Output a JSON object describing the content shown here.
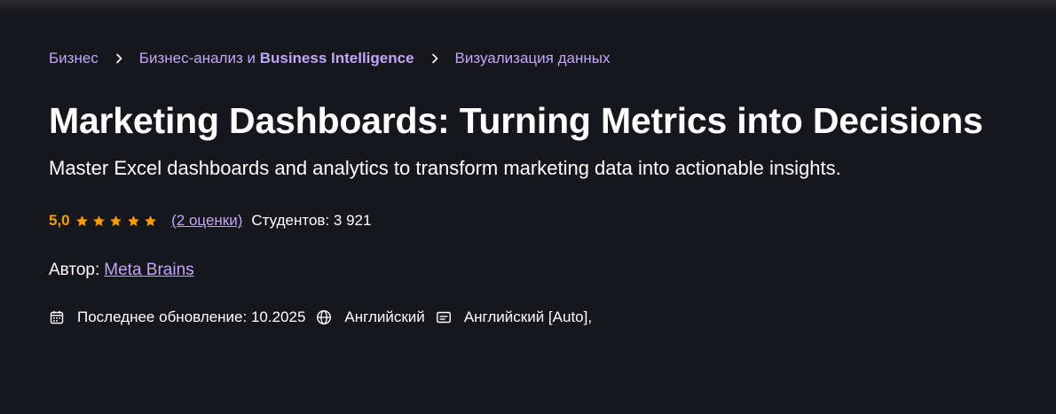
{
  "breadcrumb": {
    "items": [
      {
        "label": "Бизнес"
      },
      {
        "label_prefix": "Бизнес-анализ и ",
        "label_bold": "Business Intelligence"
      },
      {
        "label": "Визуализация данных"
      }
    ]
  },
  "course": {
    "title": "Marketing Dashboards: Turning Metrics into Decisions",
    "subtitle": "Master Excel dashboards and analytics to transform marketing data into actionable insights."
  },
  "rating": {
    "value": "5,0",
    "stars": 5,
    "count_label": "(2 оценки)",
    "students_label": "Студентов: 3 921"
  },
  "author": {
    "label": "Автор:",
    "name": "Meta Brains"
  },
  "meta": {
    "last_update": "Последнее обновление: 10.2025",
    "language": "Английский",
    "captions": "Английский [Auto],"
  },
  "colors": {
    "background": "#16171c",
    "accent": "#c0a6fa",
    "rating": "#f69c08",
    "text": "#ffffff"
  },
  "icons": {
    "breadcrumb_separator": "chevron-right-icon",
    "rating_star": "star-icon",
    "last_update": "calendar-icon",
    "language": "globe-icon",
    "captions": "closed-captions-icon"
  }
}
